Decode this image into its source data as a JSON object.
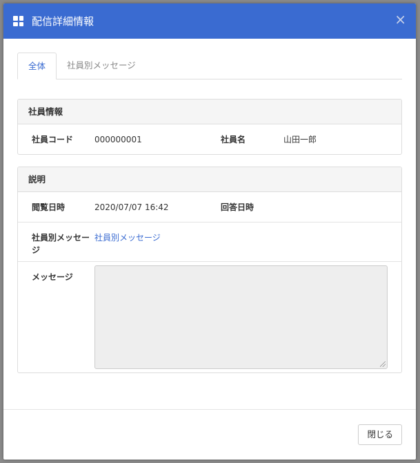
{
  "header": {
    "title": "配信詳細情報",
    "close_symbol": "×"
  },
  "tabs": [
    {
      "label": "全体",
      "active": true
    },
    {
      "label": "社員別メッセージ",
      "active": false
    }
  ],
  "employee_panel": {
    "heading": "社員情報",
    "code_label": "社員コード",
    "code_value": "000000001",
    "name_label": "社員名",
    "name_value": "山田一郎"
  },
  "description_panel": {
    "heading": "説明",
    "viewed_label": "閲覧日時",
    "viewed_value": "2020/07/07 16:42",
    "answered_label": "回答日時",
    "answered_value": "",
    "employee_msg_label": "社員別メッセージ",
    "employee_msg_link": "社員別メッセージ",
    "message_label": "メッセージ",
    "message_value": ""
  },
  "footer": {
    "close_label": "閉じる"
  },
  "colors": {
    "header": "#3a6bd1",
    "link": "#3a6bd1"
  }
}
